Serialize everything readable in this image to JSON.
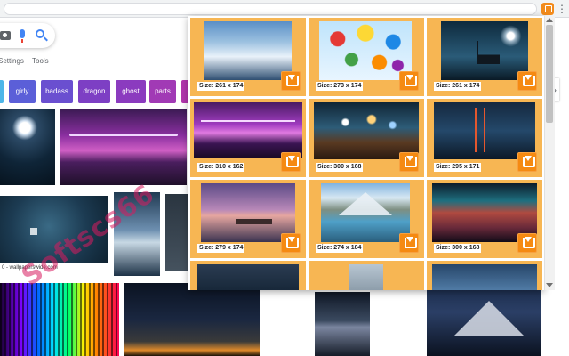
{
  "browser": {
    "menu_glyph": "⋮",
    "extension_icon": "image-downloader-extension-icon"
  },
  "google": {
    "tabs": {
      "settings": "Settings",
      "tools": "Tools"
    },
    "chips": [
      "",
      "girly",
      "badass",
      "dragon",
      "ghost",
      "parts",
      ""
    ],
    "chip_colors": [
      "#4db6e8",
      "#5b5fd8",
      "#6a4fd0",
      "#7d3fc4",
      "#8b3bbf",
      "#a13ab5",
      "#b236ad"
    ],
    "next_glyph": "›",
    "win_caption": "0 - wallpaperswide.com",
    "watermark": "Softscs66"
  },
  "popup": {
    "accent": "#f7b653",
    "button_color": "#f58a12",
    "images": [
      {
        "size": "Size: 261 x 174",
        "thumb": "sky-clouds"
      },
      {
        "size": "Size: 273 x 174",
        "thumb": "umbrellas"
      },
      {
        "size": "Size: 261 x 174",
        "thumb": "ship-moon"
      },
      {
        "size": "Size: 310 x 162",
        "thumb": "purple-bridge"
      },
      {
        "size": "Size: 300 x 168",
        "thumb": "bokeh-table"
      },
      {
        "size": "Size: 295 x 171",
        "thumb": "golden-gate"
      },
      {
        "size": "Size: 279 x 174",
        "thumb": "dock-sunset"
      },
      {
        "size": "Size: 274 x 184",
        "thumb": "mountain-lake"
      },
      {
        "size": "Size: 300 x 168",
        "thumb": "neon-mountains"
      }
    ]
  }
}
